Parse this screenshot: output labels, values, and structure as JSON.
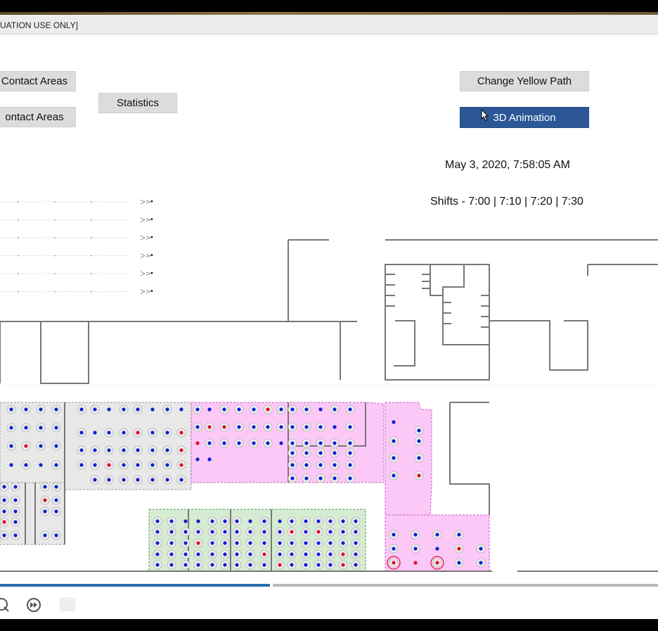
{
  "window": {
    "title": "UATION USE ONLY]"
  },
  "buttons": {
    "contact_areas_1": "Contact Areas",
    "contact_areas_2": "ontact Areas",
    "statistics": "Statistics",
    "change_yellow_path": "Change Yellow Path",
    "animation_3d": "3D Animation"
  },
  "info": {
    "datetime": "May 3, 2020, 7:58:05 AM",
    "shifts": "Shifts - 7:00 | 7:10 | 7:20 | 7:30"
  },
  "playback": {
    "progress_fraction": 0.41
  },
  "colors": {
    "accent_blue": "#2b5797",
    "zone_gray": "#e8e8e8",
    "zone_pink": "#fcc8f8",
    "zone_green": "#d6ecd2",
    "dot_blue": "#1020d0",
    "dot_red": "#e0102a"
  },
  "icons": {
    "cursor": "mouse-pointer-icon",
    "zoom": "zoom-in-icon",
    "forward": "fast-forward-icon",
    "stop": "stop-icon"
  }
}
